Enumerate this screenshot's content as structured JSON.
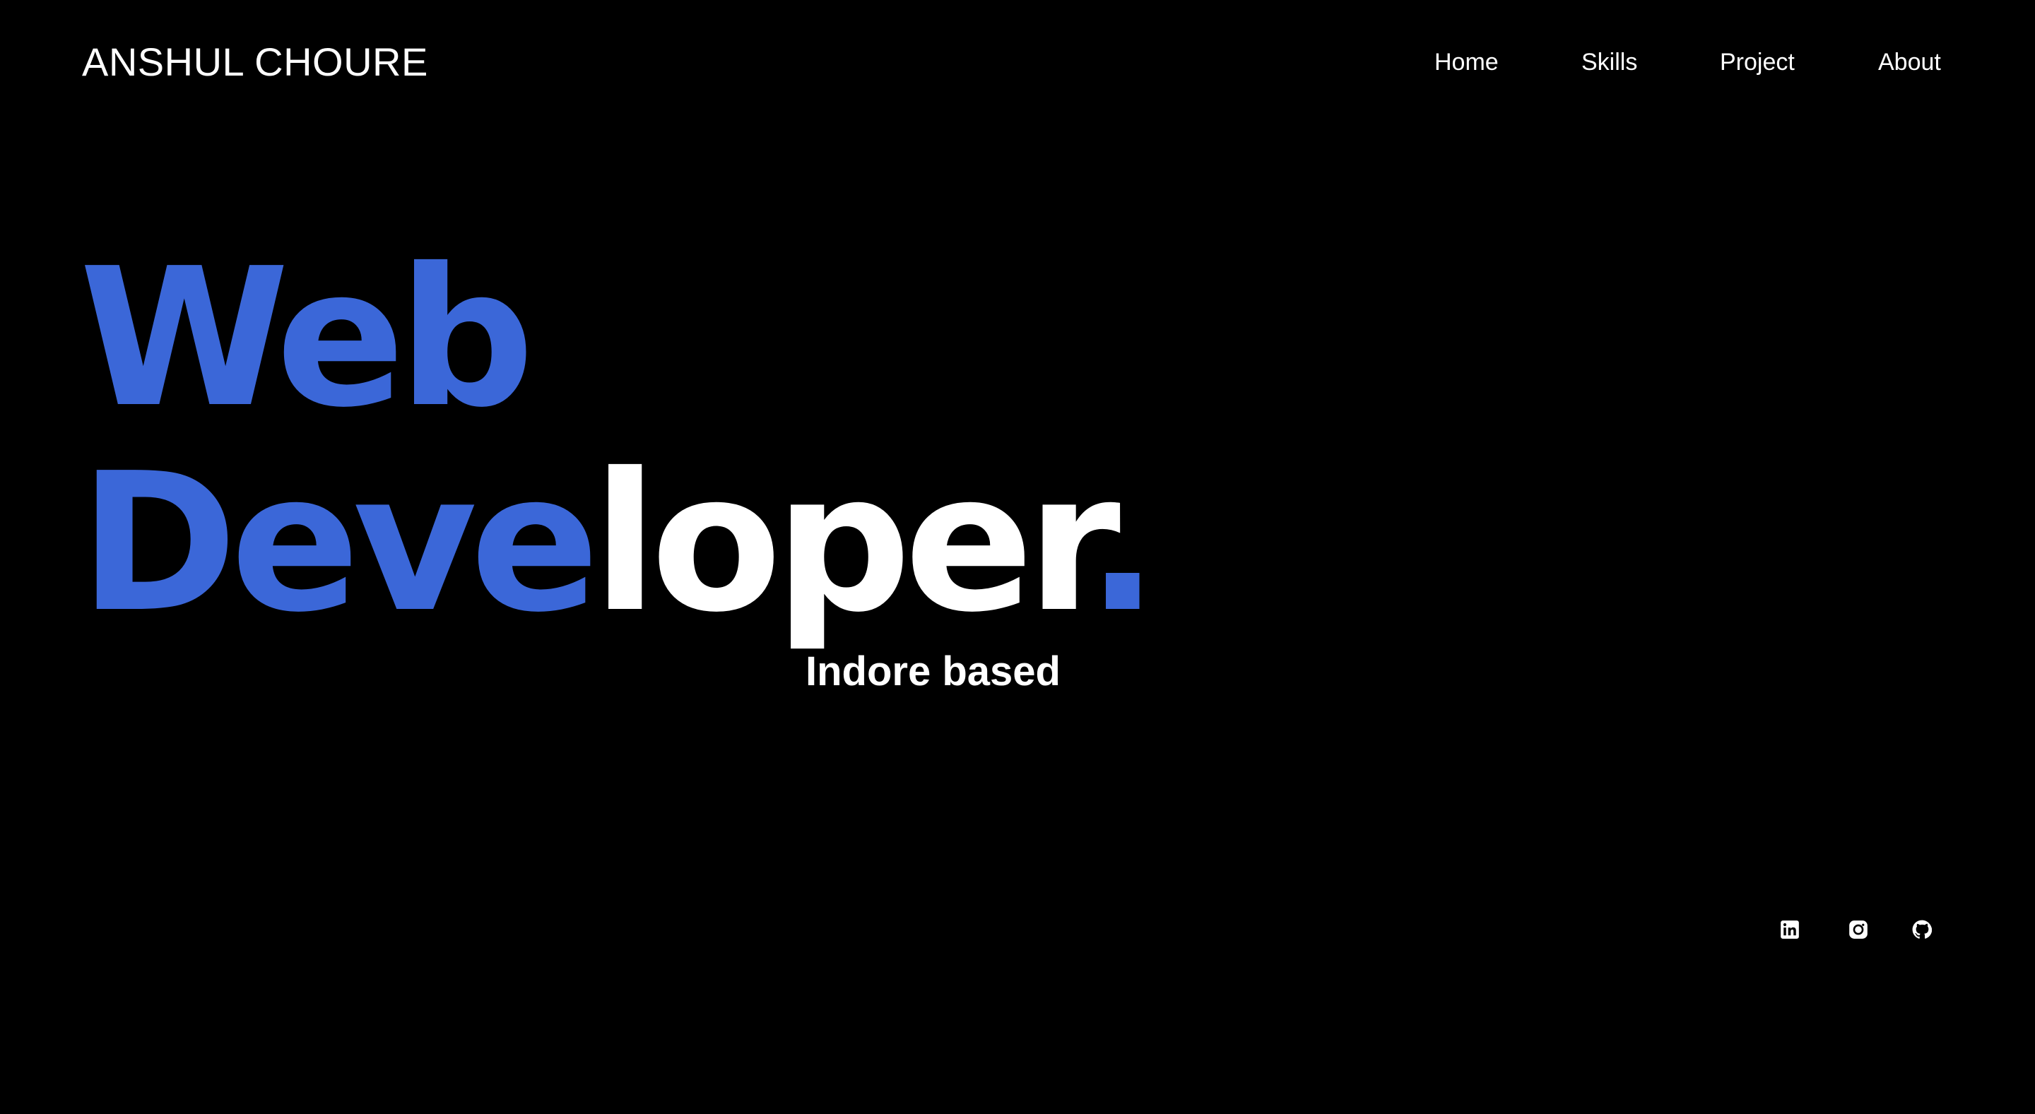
{
  "header": {
    "logo": "ANSHUL CHOURE",
    "nav": [
      {
        "label": "Home"
      },
      {
        "label": "Skills"
      },
      {
        "label": "Project"
      },
      {
        "label": "About"
      }
    ]
  },
  "hero": {
    "line1": "Web",
    "line2_blue": "Deve",
    "line2_white": "loper",
    "line2_dot": ".",
    "tagline": "Indore based"
  },
  "social": [
    {
      "name": "linkedin",
      "icon": "linkedin-icon"
    },
    {
      "name": "instagram",
      "icon": "instagram-icon"
    },
    {
      "name": "github",
      "icon": "github-icon"
    }
  ],
  "colors": {
    "background": "#000000",
    "accent": "#3b67d8",
    "text": "#ffffff"
  }
}
